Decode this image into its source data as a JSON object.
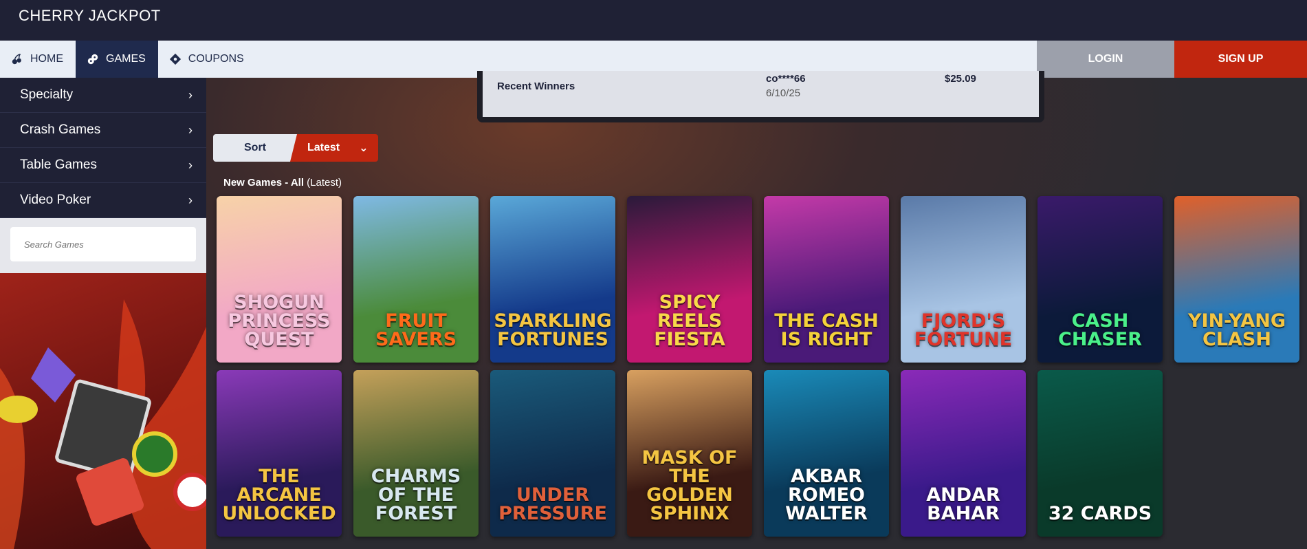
{
  "brand": {
    "logo_text": "CHERRY JACKPOT"
  },
  "nav": {
    "items": [
      {
        "label": "HOME",
        "icon": "cherry-icon",
        "active": false
      },
      {
        "label": "GAMES",
        "icon": "gamepad-icon",
        "active": true
      },
      {
        "label": "COUPONS",
        "icon": "ticket-icon",
        "active": false
      }
    ],
    "login_label": "LOGIN",
    "signup_label": "SIGN UP"
  },
  "sidebar": {
    "items": [
      {
        "label": "Specialty"
      },
      {
        "label": "Crash Games"
      },
      {
        "label": "Table Games"
      },
      {
        "label": "Video Poker"
      }
    ],
    "search_placeholder": "Search Games"
  },
  "winners": {
    "label": "Recent Winners",
    "user": "co****66",
    "date": "6/10/25",
    "amount": "$25.09"
  },
  "sort": {
    "label": "Sort",
    "selected": "Latest"
  },
  "section": {
    "title_bold": "New Games - All",
    "title_suffix": "(Latest)"
  },
  "games": [
    {
      "title": "SHOGUN PRINCESS QUEST",
      "bg": "#f2a8c6",
      "bg2": "#f7d2a8",
      "color": "#f7c8e0"
    },
    {
      "title": "FRUIT SAVERS",
      "bg": "#4b8b3a",
      "bg2": "#7fb9e4",
      "color": "#ff6a1a"
    },
    {
      "title": "SPARKLING FORTUNES",
      "bg": "#143a8a",
      "bg2": "#5aa8d8",
      "color": "#f4c542"
    },
    {
      "title": "SPICY REELS FIESTA",
      "bg": "#c21870",
      "bg2": "#2a1a3a",
      "color": "#f8d94a"
    },
    {
      "title": "THE CASH IS RIGHT",
      "bg": "#4a1a78",
      "bg2": "#c43aa8",
      "color": "#f4d23a"
    },
    {
      "title": "FJORD'S FORTUNE",
      "bg": "#a8c4e4",
      "bg2": "#5a7aa8",
      "color": "#e0342a"
    },
    {
      "title": "CASH CHASER",
      "bg": "#0c1a3a",
      "bg2": "#3a1a6a",
      "color": "#4af08a"
    },
    {
      "title": "YIN-YANG CLASH",
      "bg": "#2a7ab8",
      "bg2": "#e0602a",
      "color": "#f4c542"
    },
    {
      "title": "THE ARCANE UNLOCKED",
      "bg": "#2a1a5a",
      "bg2": "#8a3ab8",
      "color": "#f4c542"
    },
    {
      "title": "CHARMS OF THE FOREST",
      "bg": "#3a5a2a",
      "bg2": "#c4a05a",
      "color": "#d8e8f0"
    },
    {
      "title": "UNDER PRESSURE",
      "bg": "#0e2a4a",
      "bg2": "#1a5a7a",
      "color": "#e0603a"
    },
    {
      "title": "MASK OF THE GOLDEN SPHINX",
      "bg": "#3a1a14",
      "bg2": "#d8a060",
      "color": "#f4c542"
    },
    {
      "title": "AKBAR ROMEO WALTER",
      "bg": "#0a3a5a",
      "bg2": "#1a8ab8",
      "color": "#ffffff"
    },
    {
      "title": "ANDAR BAHAR",
      "bg": "#3a1a8a",
      "bg2": "#8a2ab8",
      "color": "#ffffff"
    },
    {
      "title": "32 CARDS",
      "bg": "#0a3a2a",
      "bg2": "#0a5a4a",
      "color": "#ffffff"
    }
  ]
}
